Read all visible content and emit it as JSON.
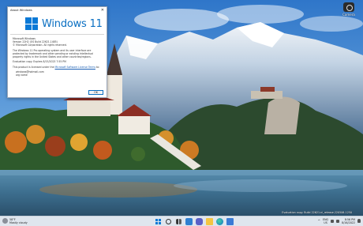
{
  "dialog": {
    "title": "About Windows",
    "close_glyph": "✕",
    "logo_text": "Windows 11",
    "lines": [
      "Microsoft Windows",
      "Version 22H2 (OS Build 22621.1485)",
      "© Microsoft Corporation. All rights reserved."
    ],
    "paragraph": "The Windows 11 Pro operating system and its user interface are protected by trademark and other pending or existing intellectual property rights in the United States and other countries/regions.",
    "expiry": "Evaluation copy. Expires 8/15/2023 7:55 PM",
    "license_prefix": "This product is licensed under the ",
    "license_link": "Microsoft Software License Terms",
    "license_to": " to:",
    "user_name": "windows@hotmail.com",
    "org_name": "org name",
    "ok_label": "OK"
  },
  "desktop": {
    "icon_name": "camera-icon",
    "icon_label": "Camera"
  },
  "taskbar": {
    "weather_temp": "58°F",
    "weather_desc": "Mostly cloudy",
    "apps": [
      "start",
      "search",
      "task-view",
      "widgets",
      "chat",
      "file-explorer",
      "edge",
      "store"
    ],
    "lang_top": "ENG",
    "lang_bottom": "US",
    "time": "8:56 PM",
    "date": "8/16/2022"
  },
  "watermark": "Evaluation copy. Build 22621.ni_release.220506-1250"
}
